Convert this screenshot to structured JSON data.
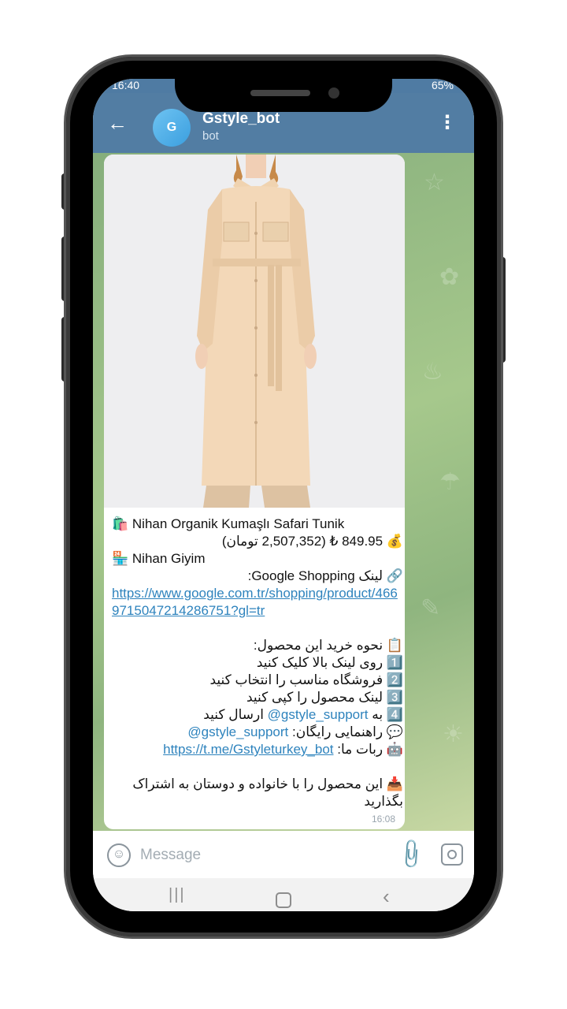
{
  "status_bar": {
    "time": "16:40",
    "right_text": "65%"
  },
  "header": {
    "back_icon": "arrow-left-icon",
    "avatar_letter": "G",
    "title": "Gstyle_bot",
    "subtitle": "bot",
    "menu_icon": "more-vertical-icon"
  },
  "message": {
    "lines": [
      {
        "dir": "ltr",
        "icon": "🛍️",
        "text": "Nihan Organik Kumaşlı Safari Tunik"
      },
      {
        "dir": "rtl",
        "icon": "💰",
        "text": "849.95 ₺ (2,507,352 تومان)"
      },
      {
        "dir": "ltr",
        "icon": "🏪",
        "text": "Nihan Giyim"
      },
      {
        "dir": "rtl",
        "icon": "🔗",
        "text": "لینک Google Shopping:"
      }
    ],
    "link": "https://www.google.com.tr/shopping/product/4669715047214286751?gl=tr",
    "howto_title": "نحوه خرید این محصول:",
    "steps": [
      "روی لینک بالا کلیک کنید",
      "فروشگاه مناسب را انتخاب کنید",
      "لینک محصول را کپی کنید"
    ],
    "send_prefix": "به",
    "support_mention": "@gstyle_support",
    "send_suffix": "ارسال کنید",
    "guide_label": "راهنمایی رایگان:",
    "guide_mention": "@gstyle_support",
    "bot_label": "ربات ما:",
    "bot_link": "https://t.me/Gstyleturkey_bot",
    "share_text": "این محصول را با خانواده و دوستان به اشتراک بگذارید",
    "time": "16:08"
  },
  "input": {
    "placeholder": "Message"
  },
  "colors": {
    "header": "#527da3",
    "link": "#2e83bd",
    "chat_bg": "#a6c88c"
  }
}
